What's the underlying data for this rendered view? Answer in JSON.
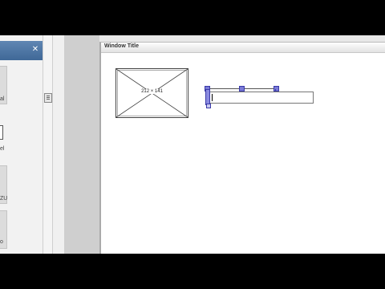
{
  "canvas": {
    "window_title": "Window Title",
    "image_placeholder": {
      "dimensions_label": "212 × 141"
    },
    "text_field": {
      "value": ""
    }
  },
  "palette": {
    "tiles": [
      {
        "label": "al",
        "icon": "component-tile-icon"
      },
      {
        "label": "el",
        "icon": "checkbox-tile-icon"
      },
      {
        "label": "ZU",
        "icon": "component-tile-icon"
      },
      {
        "label": "o",
        "icon": "component-tile-icon"
      }
    ]
  },
  "colors": {
    "selection": "#7a7ad6",
    "palette_header": "#4f77a5"
  }
}
